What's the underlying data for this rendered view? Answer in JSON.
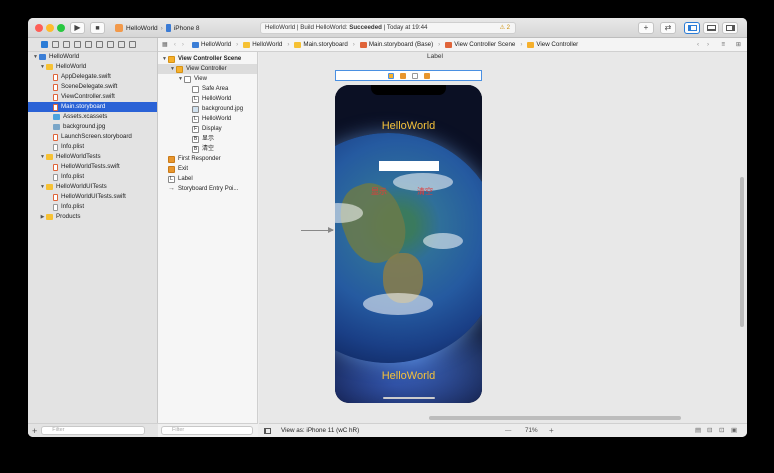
{
  "toolbar": {
    "run_icon": "play-icon",
    "stop_icon": "stop-icon",
    "scheme": "HelloWorld",
    "device": "iPhone 8",
    "status_prefix": "HelloWorld | Build HelloWorld: ",
    "status_result": "Succeeded",
    "status_time": " | Today at 19:44",
    "warning_count": "2",
    "add_label": "+",
    "swap_label": "⇄"
  },
  "navigator": {
    "items": [
      {
        "label": "HelloWorld",
        "type": "project"
      },
      {
        "label": "HelloWorld",
        "type": "folder"
      },
      {
        "label": "AppDelegate.swift",
        "type": "swift"
      },
      {
        "label": "SceneDelegate.swift",
        "type": "swift"
      },
      {
        "label": "ViewController.swift",
        "type": "swift"
      },
      {
        "label": "Main.storyboard",
        "type": "storyboard",
        "selected": true
      },
      {
        "label": "Assets.xcassets",
        "type": "assets"
      },
      {
        "label": "background.jpg",
        "type": "image"
      },
      {
        "label": "LaunchScreen.storyboard",
        "type": "storyboard"
      },
      {
        "label": "Info.plist",
        "type": "file"
      },
      {
        "label": "HelloWorldTests",
        "type": "folder"
      },
      {
        "label": "HelloWorldTests.swift",
        "type": "swift"
      },
      {
        "label": "Info.plist",
        "type": "file"
      },
      {
        "label": "HelloWorldUITests",
        "type": "folder"
      },
      {
        "label": "HelloWorldUITests.swift",
        "type": "swift"
      },
      {
        "label": "Info.plist",
        "type": "file"
      },
      {
        "label": "Products",
        "type": "folder"
      }
    ],
    "filter_placeholder": "Filter"
  },
  "jumpbar": {
    "crumbs": [
      "HelloWorld",
      "HelloWorld",
      "Main.storyboard",
      "Main.storyboard (Base)",
      "View Controller Scene",
      "View Controller"
    ]
  },
  "outline": {
    "items": [
      {
        "label": "View Controller Scene",
        "level": 0,
        "icon": "y"
      },
      {
        "label": "View Controller",
        "level": 1,
        "icon": "y"
      },
      {
        "label": "View",
        "level": 2,
        "icon": "plain"
      },
      {
        "label": "Safe Area",
        "level": 3,
        "icon": "plain"
      },
      {
        "label": "HelloWorld",
        "level": 3,
        "icon": "L"
      },
      {
        "label": "background.jpg",
        "level": 3,
        "icon": "img"
      },
      {
        "label": "HelloWorld",
        "level": 3,
        "icon": "L"
      },
      {
        "label": "Display",
        "level": 3,
        "icon": "F"
      },
      {
        "label": "显示",
        "level": 3,
        "icon": "B"
      },
      {
        "label": "清空",
        "level": 3,
        "icon": "B"
      },
      {
        "label": "First Responder",
        "level": 0,
        "icon": "o"
      },
      {
        "label": "Exit",
        "level": 0,
        "icon": "o"
      },
      {
        "label": "Label",
        "level": 0,
        "icon": "L"
      },
      {
        "label": "Storyboard Entry Poi...",
        "level": 0,
        "icon": "arrow"
      }
    ],
    "filter_placeholder": "Filter"
  },
  "canvas": {
    "scene_label": "Label",
    "hello_top": "HelloWorld",
    "show_button": "显示",
    "clear_button": "清空",
    "hello_bottom": "HelloWorld"
  },
  "bottom_bar": {
    "view_as": "View as: iPhone 11 (",
    "view_as_shortcut": "wC hR",
    "view_as_end": ")",
    "zoom_minus": "—",
    "zoom": "71%",
    "zoom_plus": "+"
  },
  "colors": {
    "accent": "#2a62d6",
    "title_yellow": "#f5c23a",
    "button_red": "#e03a3a"
  }
}
